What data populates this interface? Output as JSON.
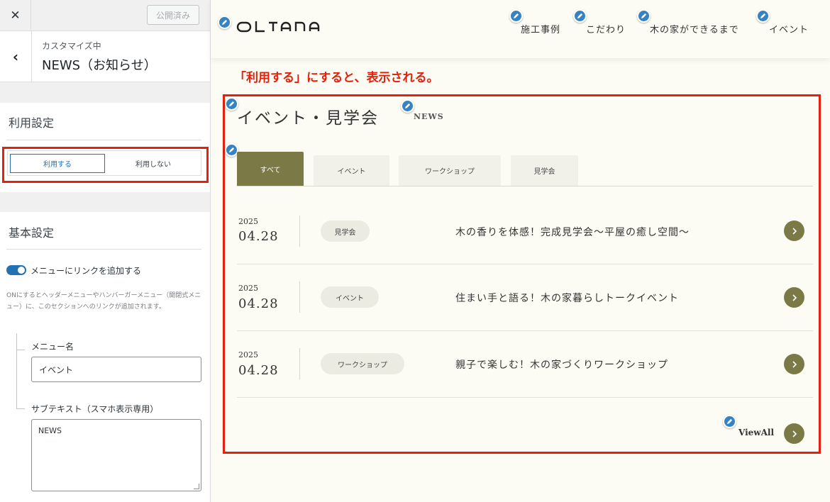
{
  "sidebar": {
    "close_icon": "close-icon",
    "publish_label": "公開済み",
    "breadcrumb": "カスタマイズ中",
    "title": "NEWS（お知らせ）",
    "use_section": {
      "title": "利用設定",
      "options": [
        "利用する",
        "利用しない"
      ],
      "selected": "利用する"
    },
    "basic_section": {
      "title": "基本設定",
      "toggle_label": "メニューにリンクを追加する",
      "toggle_on": true,
      "description": "ONにするとヘッダーメニューやハンバーガーメニュー（開閉式メニュー）に、このセクションへのリンクが追加されます。",
      "menu_name_label": "メニュー名",
      "menu_name_value": "イベント",
      "subtext_label": "サブテキスト（スマホ表示専用）",
      "subtext_value": "NEWS"
    }
  },
  "preview": {
    "logo": "OLTANA",
    "nav": [
      "施工事例",
      "こだわり",
      "木の家ができるまで",
      "イベント"
    ],
    "annotation": "「利用する」にすると、表示される。",
    "news": {
      "title": "イベント・見学会",
      "subtitle": "NEWS",
      "tabs": [
        "すべて",
        "イベント",
        "ワークショップ",
        "見学会"
      ],
      "active_tab": "すべて",
      "items": [
        {
          "year": "2025",
          "date": "04.28",
          "tag": "見学会",
          "text": "木の香りを体感！完成見学会〜平屋の癒し空間〜"
        },
        {
          "year": "2025",
          "date": "04.28",
          "tag": "イベント",
          "text": "住まい手と語る！木の家暮らしトークイベント"
        },
        {
          "year": "2025",
          "date": "04.28",
          "tag": "ワークショップ",
          "text": "親子で楽しむ！木の家づくりワークショップ"
        }
      ],
      "view_all": "ViewAll"
    }
  },
  "colors": {
    "accent_olive": "#7b7a47",
    "highlight_red": "#e3210d",
    "wp_blue": "#2271b1"
  }
}
